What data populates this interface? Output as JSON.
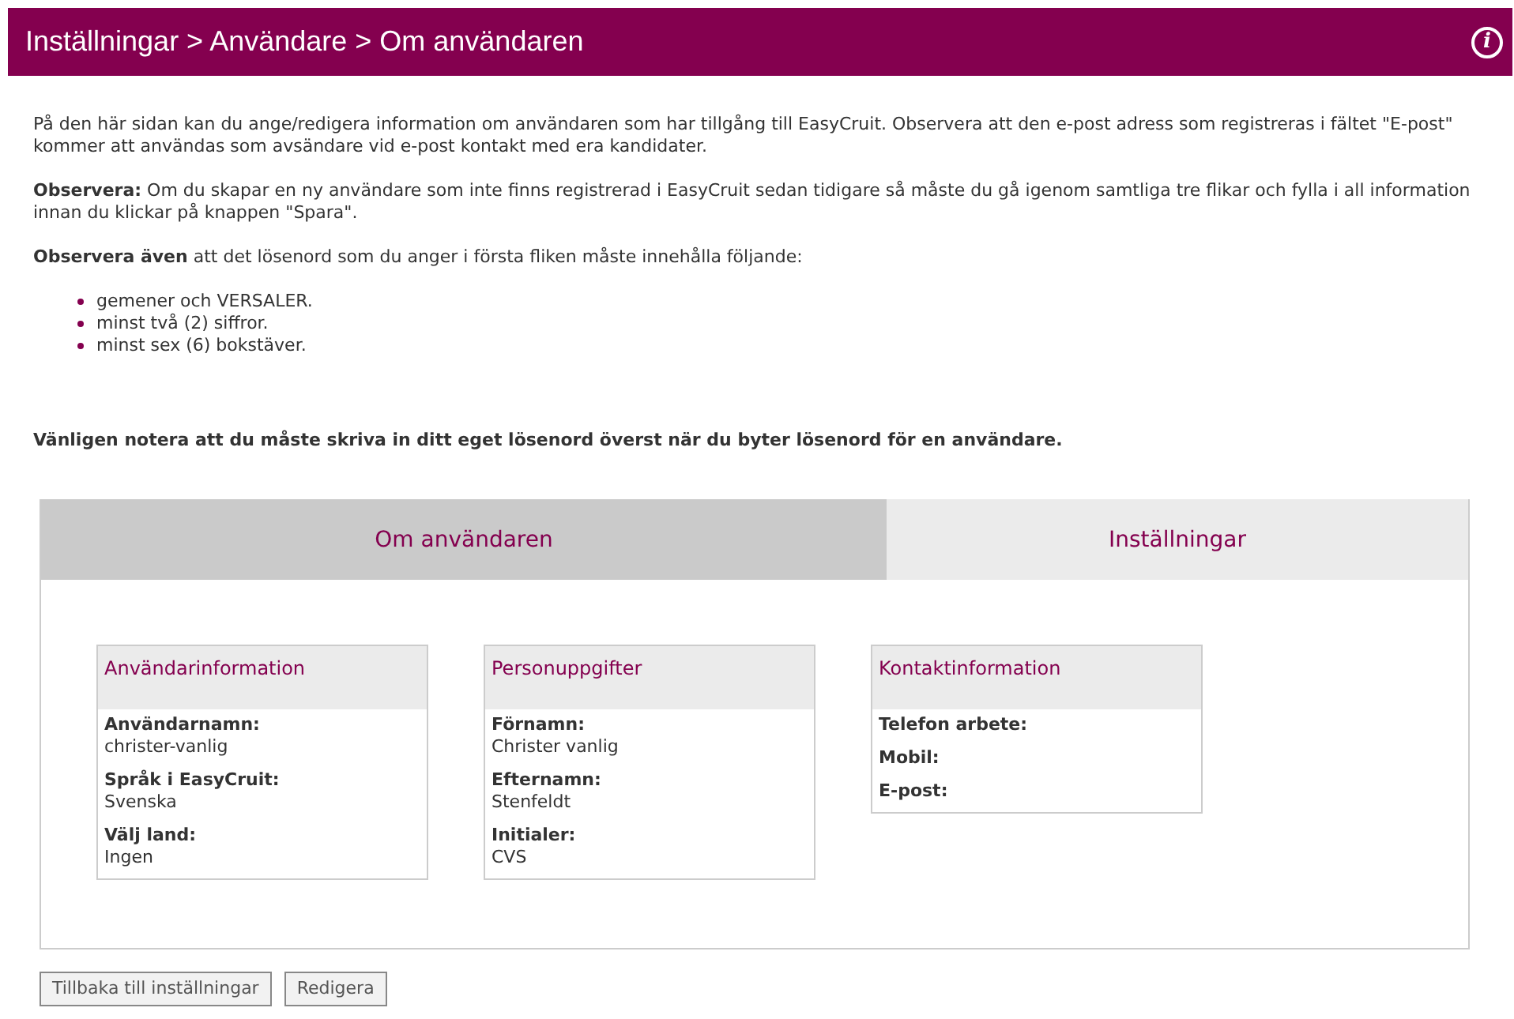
{
  "header": {
    "title": "Inställningar > Användare > Om användaren",
    "info_icon": "i"
  },
  "paragraphs": [
    "På den här sidan kan du ange/redigera information om användaren som har tillgång till EasyCruit. Observera att den e-post adress som registreras i fältet \"E-post\" kommer att användas som avsändare vid e-post kontakt med era kandidater.",
    "**Observera:** Om du skapar en ny användare som inte finns registrerad i EasyCruit sedan tidigare så måste du gå igenom samtliga tre flikar och fylla i all information innan du klickar på knappen \"Spara\".",
    "**Observera även** att det lösenord som du anger i första fliken måste innehålla följande:"
  ],
  "requirements": [
    "gemener och VERSALER.",
    "minst två (2) siffror.",
    "minst sex (6) bokstäver."
  ],
  "notice": "Vänligen notera att du måste skriva in ditt eget lösenord överst när du byter lösenord för en användare.",
  "tabs": [
    {
      "label": "Om användaren",
      "selected": true
    },
    {
      "label": "Inställningar",
      "selected": false
    }
  ],
  "cards": [
    {
      "title": "Användarinformation",
      "fields": [
        {
          "label": "Användarnamn:",
          "value": "christer-vanlig"
        },
        {
          "label": "Språk i EasyCruit:",
          "value": "Svenska"
        },
        {
          "label": "Välj land:",
          "value": "Ingen"
        }
      ]
    },
    {
      "title": "Personuppgifter",
      "fields": [
        {
          "label": "Förnamn:",
          "value": "Christer vanlig"
        },
        {
          "label": "Efternamn:",
          "value": "Stenfeldt"
        },
        {
          "label": "Initialer:",
          "value": "CVS"
        }
      ]
    },
    {
      "title": "Kontaktinformation",
      "fields": [
        {
          "label": "Telefon arbete:"
        },
        {
          "label": "Mobil:"
        },
        {
          "label": "E-post:"
        }
      ]
    }
  ],
  "buttons": [
    "Tillbaka till inställningar",
    "Redigera"
  ]
}
